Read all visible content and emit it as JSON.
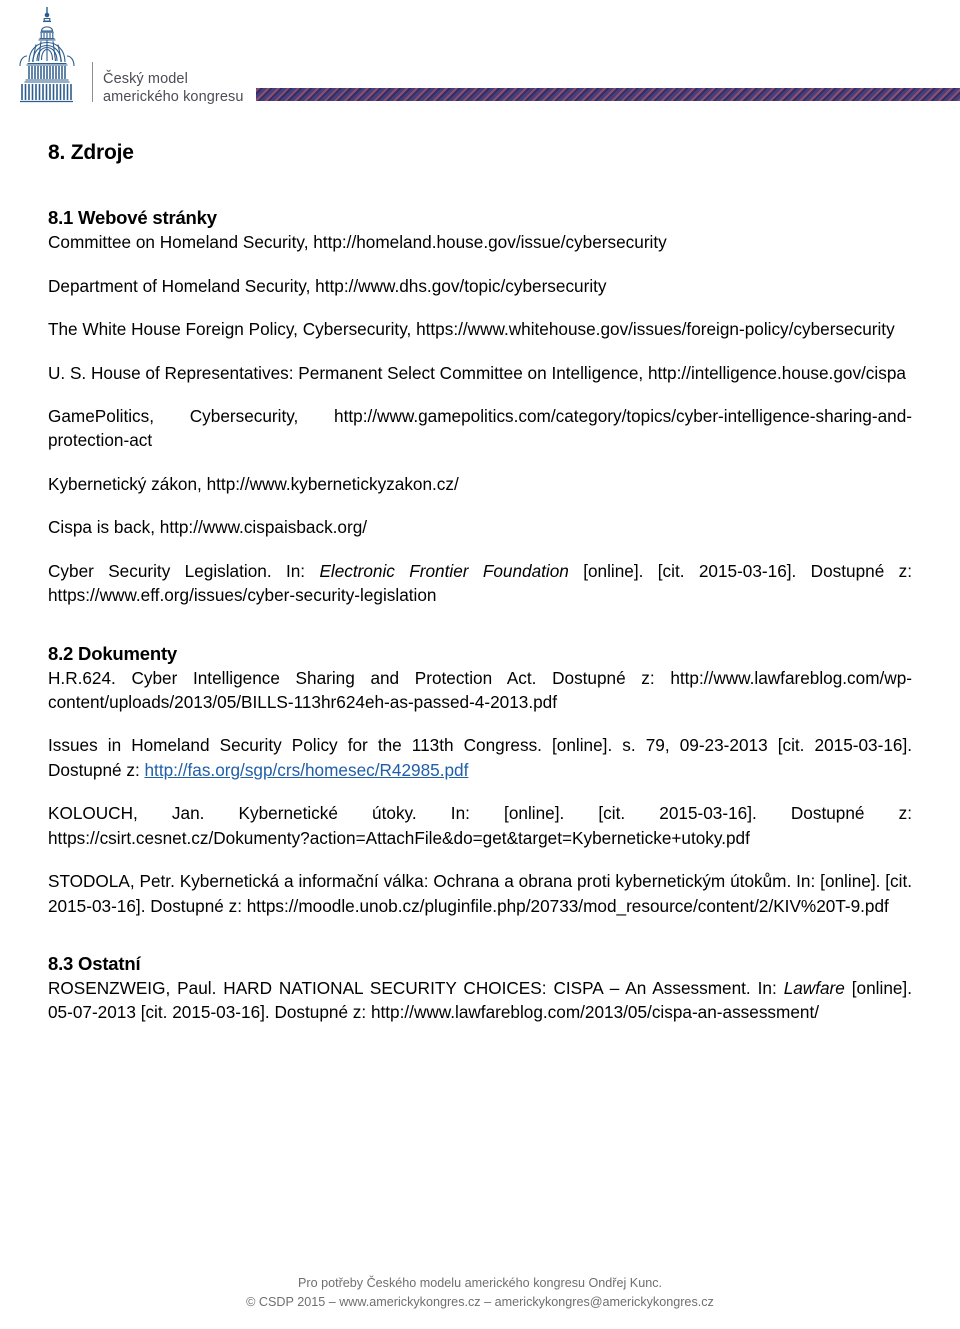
{
  "header": {
    "logo_line1": "Český model",
    "logo_line2": "amerického kongresu",
    "logo_icon": "capitol-dome-icon",
    "stripe_colors": [
      "#3b3670",
      "#8e4f6d",
      "#463f7e"
    ]
  },
  "document": {
    "section_title": "8. Zdroje",
    "subsections": [
      {
        "id": "8.1",
        "heading": "8.1 Webové stránky",
        "entries": [
          "Committee on Homeland Security, http://homeland.house.gov/issue/cybersecurity",
          "Department of Homeland Security, http://www.dhs.gov/topic/cybersecurity",
          "The White House Foreign Policy, Cybersecurity, https://www.whitehouse.gov/issues/foreign-policy/cybersecurity",
          "U. S. House of Representatives: Permanent Select Committee on Intelligence, http://intelligence.house.gov/cispa",
          "GamePolitics, Cybersecurity, http://www.gamepolitics.com/category/topics/cyber-intelligence-sharing-and-protection-act",
          "Kybernetický zákon, http://www.kybernetickyzakon.cz/",
          "Cispa is back, http://www.cispaisback.org/"
        ],
        "eff_entry": {
          "pre": "Cyber Security Legislation. In: ",
          "italic": "Electronic Frontier Foundation",
          "post": " [online]. [cit. 2015-03-16]. Dostupné z: https://www.eff.org/issues/cyber-security-legislation"
        }
      },
      {
        "id": "8.2",
        "heading": "8.2 Dokumenty",
        "entries": [
          "H.R.624. Cyber Intelligence Sharing and Protection Act. Dostupné z: http://www.lawfareblog.com/wp-content/uploads/2013/05/BILLS-113hr624eh-as-passed-4-2013.pdf",
          "KOLOUCH, Jan. Kybernetické útoky. In: [online]. [cit. 2015-03-16]. Dostupné z: https://csirt.cesnet.cz/Dokumenty?action=AttachFile&do=get&target=Kyberneticke+utoky.pdf",
          "STODOLA, Petr. Kybernetická a informační válka: Ochrana a obrana proti kybernetickým útokům. In: [online]. [cit. 2015-03-16]. Dostupné z: https://moodle.unob.cz/pluginfile.php/20733/mod_resource/content/2/KIV%20T-9.pdf"
        ],
        "crs_entry": {
          "pre": "Issues in Homeland Security Policy for the 113th Congress. [online]. s. 79, 09-23-2013 [cit. 2015-03-16]. Dostupné z: ",
          "link": "http://fas.org/sgp/crs/homesec/R42985.pdf",
          "link_color": "#1f5fa9"
        }
      },
      {
        "id": "8.3",
        "heading": "8.3 Ostatní",
        "rosenzweig_entry": {
          "pre": "ROSENZWEIG, Paul. HARD NATIONAL SECURITY CHOICES: CISPA – An Assessment. In: ",
          "italic": "Lawfare",
          "post": " [online]. 05-07-2013 [cit. 2015-03-16]. Dostupné z: http://www.lawfareblog.com/2013/05/cispa-an-assessment/"
        }
      }
    ]
  },
  "footer": {
    "line1": "Pro potřeby Českého modelu amerického kongresu Ondřej Kunc.",
    "line2": "© CSDP 2015 – www.americkykongres.cz – americkykongres@americkykongres.cz"
  }
}
